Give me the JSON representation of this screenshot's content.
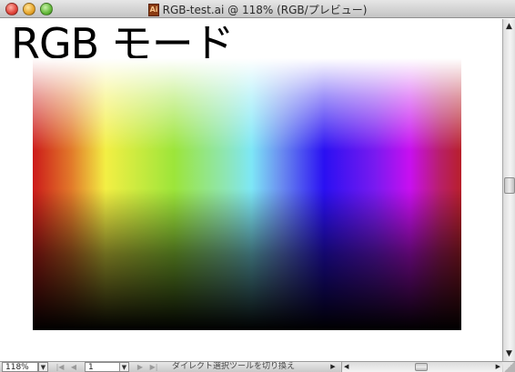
{
  "window": {
    "title": "RGB-test.ai @ 118% (RGB/プレビュー)",
    "doc_icon_label": "Ai"
  },
  "canvas": {
    "heading": "RGB モード",
    "swatch_colors": {
      "red": "#cc1a1a",
      "yellow": "#f3ef44",
      "green": "#9ce53a",
      "cyan": "#7ee7f6",
      "blue": "#2a10f2",
      "magenta": "#c80ff0"
    }
  },
  "scrollbar": {
    "up_arrow": "▲",
    "down_arrow": "▼"
  },
  "statusbar": {
    "zoom_value": "118%",
    "zoom_drop": "▼",
    "nav_first": "|◀",
    "nav_prev": "◀",
    "page_value": "1",
    "page_drop": "▼",
    "nav_next": "▶",
    "nav_last": "▶|",
    "status_text": "ダイレクト選択ツールを切り換え",
    "status_menu": "▶",
    "hscroll_left": "◀",
    "hscroll_right": "▶"
  }
}
